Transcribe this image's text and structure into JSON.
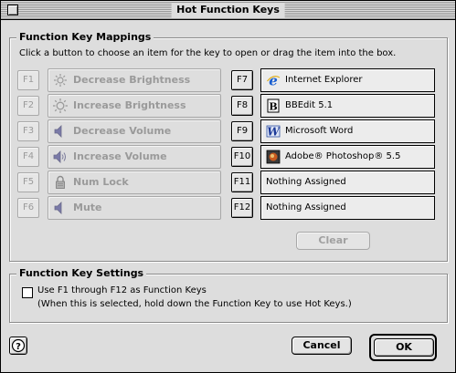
{
  "window": {
    "title": "Hot Function Keys"
  },
  "mappings": {
    "title": "Function Key Mappings",
    "instructions": "Click a button to choose an item for the key to open or drag the item into the box.",
    "hardware_keys": [
      {
        "key": "F1",
        "label": "Decrease Brightness",
        "icon": "sun-small-icon"
      },
      {
        "key": "F2",
        "label": "Increase Brightness",
        "icon": "sun-large-icon"
      },
      {
        "key": "F3",
        "label": "Decrease Volume",
        "icon": "speaker-low-icon"
      },
      {
        "key": "F4",
        "label": "Increase Volume",
        "icon": "speaker-high-icon"
      },
      {
        "key": "F5",
        "label": "Num Lock",
        "icon": "padlock-icon"
      },
      {
        "key": "F6",
        "label": "Mute",
        "icon": "speaker-mute-icon"
      }
    ],
    "assignable_keys": [
      {
        "key": "F7",
        "app": "Internet Explorer",
        "icon": "internet-explorer-icon"
      },
      {
        "key": "F8",
        "app": "BBEdit 5.1",
        "icon": "bbedit-icon"
      },
      {
        "key": "F9",
        "app": "Microsoft Word",
        "icon": "microsoft-word-icon"
      },
      {
        "key": "F10",
        "app": "Adobe® Photoshop® 5.5",
        "icon": "photoshop-icon"
      },
      {
        "key": "F11",
        "app": "Nothing Assigned",
        "icon": ""
      },
      {
        "key": "F12",
        "app": "Nothing Assigned",
        "icon": ""
      }
    ],
    "clear_label": "Clear"
  },
  "settings": {
    "title": "Function Key Settings",
    "checkbox_label": "Use F1 through F12 as Function Keys",
    "checkbox_checked": false,
    "note": "(When this is selected, hold down the Function Key to use Hot Keys.)"
  },
  "footer": {
    "help_icon": "help-icon",
    "cancel_label": "Cancel",
    "ok_label": "OK"
  }
}
